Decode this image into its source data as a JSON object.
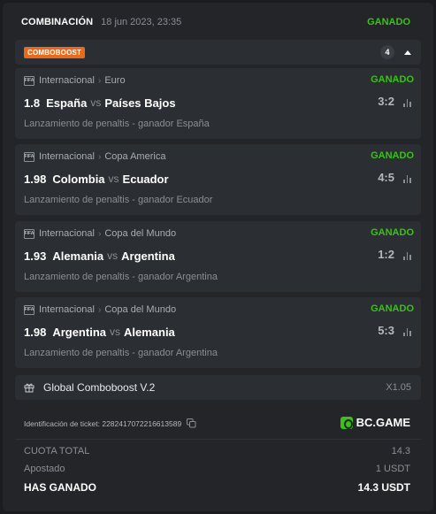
{
  "header": {
    "title": "COMBINACIÓN",
    "date": "18 jun 2023, 23:35",
    "status": "GANADO"
  },
  "boost": {
    "tag": "COMBOBOOST",
    "count": "4"
  },
  "bets": [
    {
      "league_type": "Internacional",
      "competition": "Euro",
      "status": "GANADO",
      "odds": "1.8",
      "home": "España",
      "vs": "vs",
      "away": "Países Bajos",
      "score": "3:2",
      "market": "Lanzamiento de penaltis - ganador España"
    },
    {
      "league_type": "Internacional",
      "competition": "Copa America",
      "status": "GANADO",
      "odds": "1.98",
      "home": "Colombia",
      "vs": "vs",
      "away": "Ecuador",
      "score": "4:5",
      "market": "Lanzamiento de penaltis - ganador Ecuador"
    },
    {
      "league_type": "Internacional",
      "competition": "Copa del Mundo",
      "status": "GANADO",
      "odds": "1.93",
      "home": "Alemania",
      "vs": "vs",
      "away": "Argentina",
      "score": "1:2",
      "market": "Lanzamiento de penaltis - ganador Argentina"
    },
    {
      "league_type": "Internacional",
      "competition": "Copa del Mundo",
      "status": "GANADO",
      "odds": "1.98",
      "home": "Argentina",
      "vs": "vs",
      "away": "Alemania",
      "score": "5:3",
      "market": "Lanzamiento de penaltis - ganador Argentina"
    }
  ],
  "global_boost": {
    "label": "Global Comboboost V.2",
    "multiplier": "X1.05"
  },
  "ticket": {
    "label": "Identificación de ticket: 2282417072216613589"
  },
  "brand": {
    "name": "BC.GAME"
  },
  "summary": {
    "total_odds_label": "CUOTA TOTAL",
    "total_odds_value": "14.3",
    "staked_label": "Apostado",
    "staked_value": "1 USDT",
    "won_label": "HAS GANADO",
    "won_value": "14.3 USDT"
  },
  "colors": {
    "win_green": "#3bc117",
    "boost_orange": "#ea6a1c",
    "background": "#1a1c1f",
    "card": "#232529",
    "row": "#2b2e33"
  },
  "icons": {
    "league": "fifa-icon",
    "stats": "bar-chart-icon",
    "collapse": "caret-up-icon",
    "gift": "gift-icon",
    "copy": "copy-icon"
  }
}
